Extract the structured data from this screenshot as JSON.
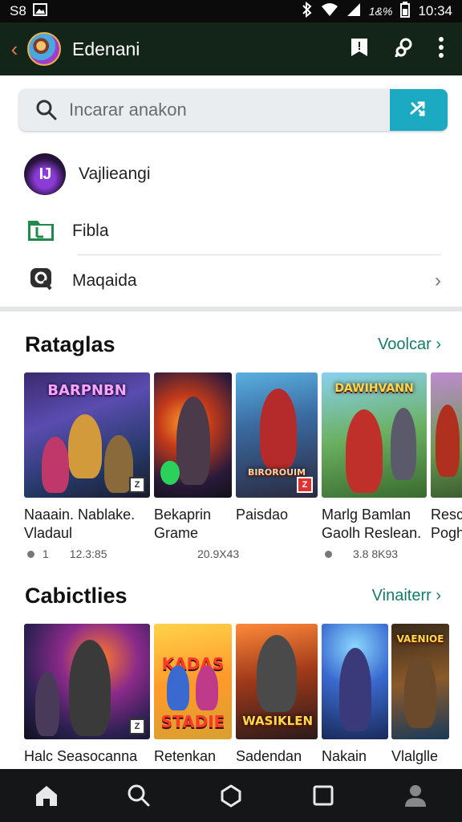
{
  "status_bar": {
    "left_text": "S8",
    "right_text": "1&%",
    "time": "10:34",
    "icons": [
      "image-icon",
      "bluetooth-icon",
      "wifi-icon",
      "signal-icon",
      "battery-icon"
    ]
  },
  "app_bar": {
    "title": "Edenani",
    "icons": [
      "back-icon",
      "avatar",
      "bookmark-icon",
      "account-switch-icon",
      "more-vert-icon"
    ],
    "colors": {
      "background": "#132419",
      "back_arrow": "#e07a50"
    }
  },
  "search": {
    "placeholder": "Incarar anakon",
    "button_icon": "shuffle-icon",
    "button_color": "#1ca9c2"
  },
  "quick_items": [
    {
      "label": "Vajlieangi",
      "icon": "app-logo-icon",
      "icon_text": "IJ"
    },
    {
      "label": "Fibla",
      "icon": "folder-icon"
    },
    {
      "label": "Maqaida",
      "icon": "chat-search-icon",
      "chevron": "›"
    }
  ],
  "sections": [
    {
      "title": "Rataglas",
      "link": "Voolcar ›",
      "items": [
        {
          "name_line1": "Naaain. Nablake.",
          "name_line2": "Vladaul",
          "rating": "1",
          "size": "12.3:85",
          "banner": "BARPNBN"
        },
        {
          "name_line1": "Bekaprin",
          "name_line2": "Grame",
          "rating": "",
          "size": "20.9X43",
          "banner": ""
        },
        {
          "name_line1": "Paisdao",
          "name_line2": "",
          "rating": "",
          "size": "",
          "banner": "BIROROUIM"
        },
        {
          "name_line1": "Marlg Bamlan",
          "name_line2": "Gaolh Reslean.",
          "rating": "",
          "size": "3.8 8K93",
          "banner": "DAWIHVANN"
        },
        {
          "name_line1": "Resc",
          "name_line2": "Pogh",
          "rating": "",
          "size": "",
          "banner": ""
        }
      ]
    },
    {
      "title": "Cabictlies",
      "link": "Vinaiterr ›",
      "items": [
        {
          "name_line1": "Halc Seasocanna",
          "banner": ""
        },
        {
          "name_line1": "Retenkan",
          "banner": "KADAS STADIE"
        },
        {
          "name_line1": "Sadendan",
          "banner": "WASIKLEN"
        },
        {
          "name_line1": "Nakain",
          "banner": ""
        },
        {
          "name_line1": "Vlalglle",
          "banner": "VAENIOE"
        }
      ]
    }
  ],
  "bottom_nav": {
    "icons": [
      "home-icon",
      "search-icon",
      "hexagon-icon",
      "square-icon",
      "profile-icon"
    ]
  }
}
